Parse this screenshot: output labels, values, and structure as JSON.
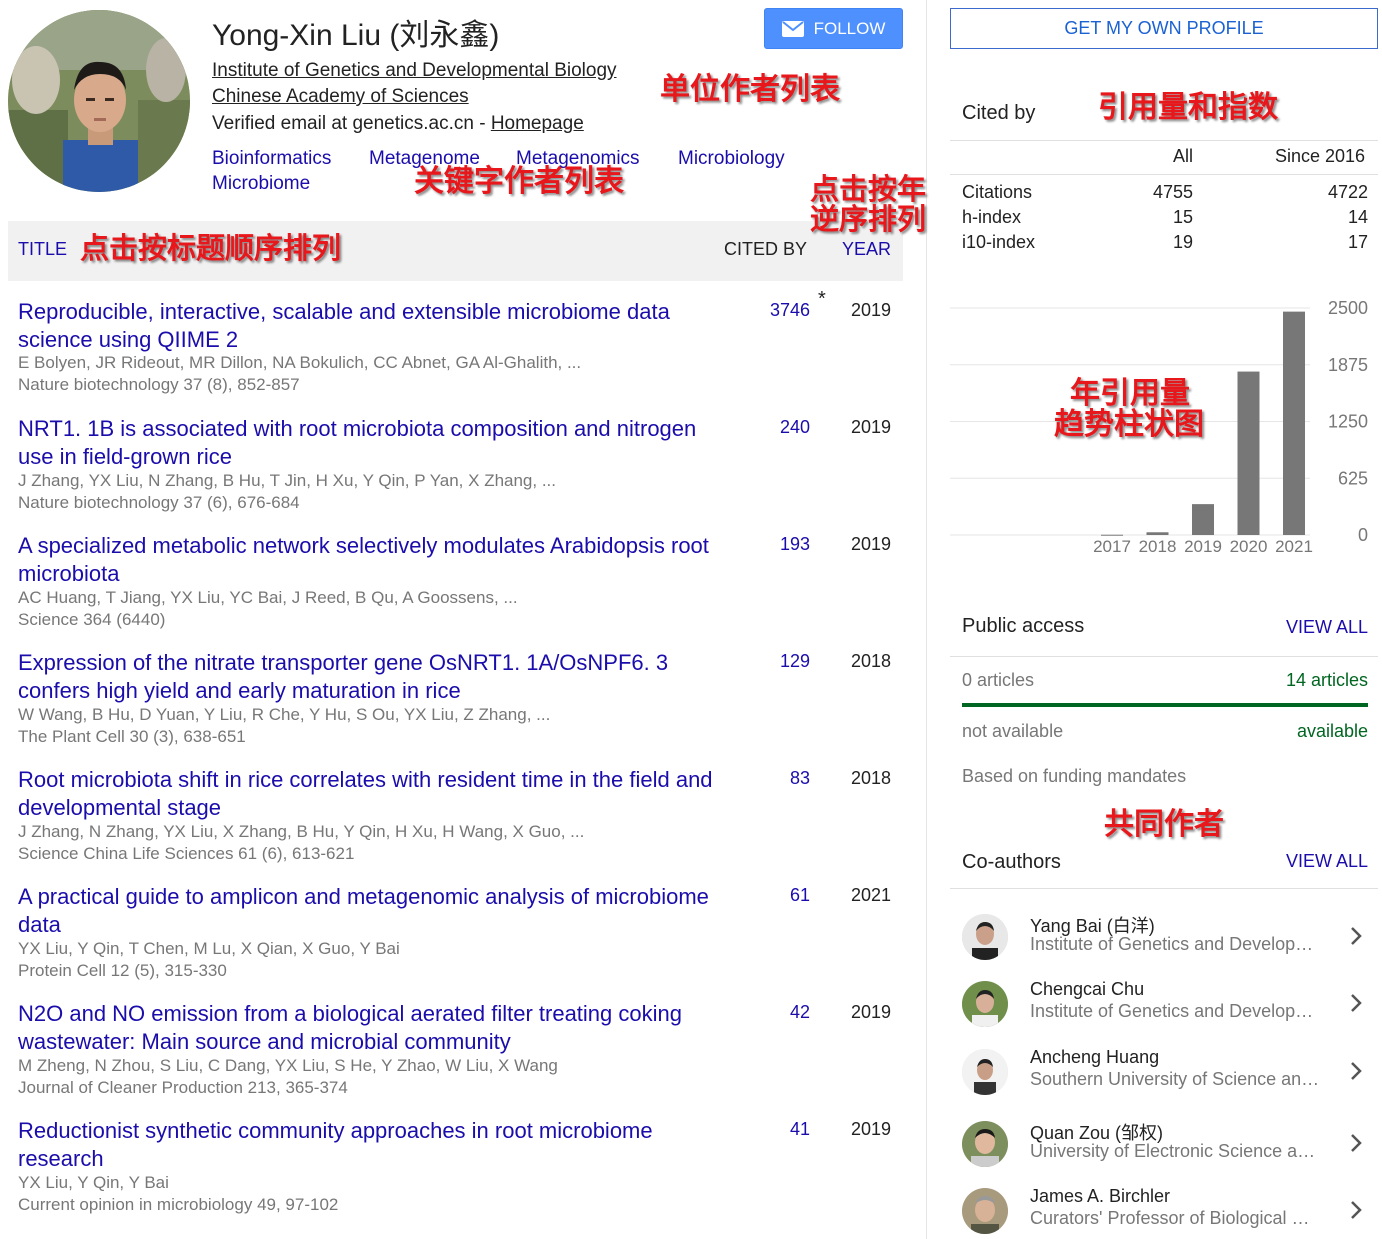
{
  "profile": {
    "name": "Yong-Xin Liu (刘永鑫)",
    "follow_label": "FOLLOW",
    "affiliation_line1": "Institute of Genetics and Developmental Biology",
    "affiliation_line2": "Chinese Academy of Sciences",
    "email_text": "Verified email at genetics.ac.cn - ",
    "homepage_label": "Homepage",
    "keywords": [
      "Bioinformatics",
      "Metagenome",
      "Metagenomics",
      "Microbiology",
      "Microbiome"
    ]
  },
  "annotations": {
    "institution_list": "单位作者列表",
    "keyword_list": "关键字作者列表",
    "sort_by_year_line1": "点击按年",
    "sort_by_year_line2": "逆序排列",
    "sort_by_title": "点击按标题顺序排列",
    "citation_index": "引用量和指数",
    "chart_line1": "年引用量",
    "chart_line2": "趋势柱状图",
    "coauthors": "共同作者"
  },
  "table": {
    "title_label": "TITLE",
    "cited_by_label": "CITED BY",
    "year_label": "YEAR",
    "star": "*"
  },
  "articles": [
    {
      "title": "Reproducible, interactive, scalable and extensible microbiome data science using QIIME 2",
      "authors": "E Bolyen, JR Rideout, MR Dillon, NA Bokulich, CC Abnet, GA Al-Ghalith, ...",
      "venue": "Nature biotechnology 37 (8), 852-857",
      "cited": "3746",
      "year": "2019"
    },
    {
      "title": "NRT1. 1B is associated with root microbiota composition and nitrogen use in field-grown rice",
      "authors": "J Zhang, YX Liu, N Zhang, B Hu, T Jin, H Xu, Y Qin, P Yan, X Zhang, ...",
      "venue": "Nature biotechnology 37 (6), 676-684",
      "cited": "240",
      "year": "2019"
    },
    {
      "title": "A specialized metabolic network selectively modulates Arabidopsis root microbiota",
      "authors": "AC Huang, T Jiang, YX Liu, YC Bai, J Reed, B Qu, A Goossens, ...",
      "venue": "Science 364 (6440)",
      "cited": "193",
      "year": "2019"
    },
    {
      "title": "Expression of the nitrate transporter gene OsNRT1. 1A/OsNPF6. 3 confers high yield and early maturation in rice",
      "authors": "W Wang, B Hu, D Yuan, Y Liu, R Che, Y Hu, S Ou, YX Liu, Z Zhang, ...",
      "venue": "The Plant Cell 30 (3), 638-651",
      "cited": "129",
      "year": "2018"
    },
    {
      "title": "Root microbiota shift in rice correlates with resident time in the field and developmental stage",
      "authors": "J Zhang, N Zhang, YX Liu, X Zhang, B Hu, Y Qin, H Xu, H Wang, X Guo, ...",
      "venue": "Science China Life Sciences 61 (6), 613-621",
      "cited": "83",
      "year": "2018"
    },
    {
      "title": "A practical guide to amplicon and metagenomic analysis of microbiome data",
      "authors": "YX Liu, Y Qin, T Chen, M Lu, X Qian, X Guo, Y Bai",
      "venue": "Protein Cell 12 (5), 315-330",
      "cited": "61",
      "year": "2021"
    },
    {
      "title": "N2O and NO emission from a biological aerated filter treating coking wastewater: Main source and microbial community",
      "authors": "M Zheng, N Zhou, S Liu, C Dang, YX Liu, S He, Y Zhao, W Liu, X Wang",
      "venue": "Journal of Cleaner Production 213, 365-374",
      "cited": "42",
      "year": "2019"
    },
    {
      "title": "Reductionist synthetic community approaches in root microbiome research",
      "authors": "YX Liu, Y Qin, Y Bai",
      "venue": "Current opinion in microbiology 49, 97-102",
      "cited": "41",
      "year": "2019"
    }
  ],
  "sidebar": {
    "get_profile_label": "GET MY OWN PROFILE",
    "cited_by_title": "Cited by",
    "col_all": "All",
    "col_since": "Since 2016",
    "stats": [
      {
        "label": "Citations",
        "all": "4755",
        "since": "4722"
      },
      {
        "label": "h-index",
        "all": "15",
        "since": "14"
      },
      {
        "label": "i10-index",
        "all": "19",
        "since": "17"
      }
    ],
    "public_access_title": "Public access",
    "view_all_label": "VIEW ALL",
    "pa_left_count": "0 articles",
    "pa_right_count": "14 articles",
    "pa_left_status": "not available",
    "pa_right_status": "available",
    "pa_note": "Based on funding mandates",
    "pa_available_fraction": 1.0,
    "coauthors_title": "Co-authors",
    "coauthors": [
      {
        "name": "Yang Bai (白洋)",
        "affiliation": "Institute of Genetics and Developmental Biology"
      },
      {
        "name": "Chengcai Chu",
        "affiliation": "Institute of Genetics and Developmental Biology"
      },
      {
        "name": "Ancheng Huang",
        "affiliation": "Southern University of Science and Technology"
      },
      {
        "name": "Quan Zou (邹权)",
        "affiliation": "University of Electronic Science and Technology"
      },
      {
        "name": "James A. Birchler",
        "affiliation": "Curators' Professor of Biological Sciences"
      }
    ]
  },
  "colors": {
    "link": "#1a0dab",
    "follow_button": "#4d90fe",
    "bar": "#777777",
    "green": "#006621",
    "annotation": "#e8171b"
  },
  "chart_data": {
    "type": "bar",
    "categories": [
      "2017",
      "2018",
      "2019",
      "2020",
      "2021"
    ],
    "values": [
      3,
      30,
      340,
      1800,
      2460
    ],
    "ylim": [
      0,
      2500
    ],
    "yticks": [
      "0",
      "625",
      "1250",
      "1875",
      "2500"
    ],
    "grid": true
  }
}
